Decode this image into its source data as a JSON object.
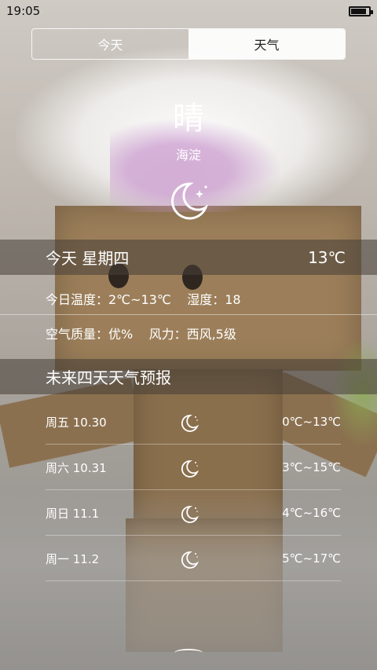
{
  "status_bar": {
    "time": "19:05",
    "battery_level": 0.85
  },
  "tabs": [
    {
      "label": "今天",
      "active": false
    },
    {
      "label": "天气",
      "active": true
    }
  ],
  "current": {
    "condition": "晴",
    "city": "海淀",
    "icon": "moon-stars-icon"
  },
  "today": {
    "label": "今天 星期四",
    "temp": "13℃",
    "temp_range": "今日温度：2℃~13℃",
    "humidity": "湿度：18",
    "air_quality": "空气质量：优%",
    "wind": "风力：西风,5级"
  },
  "forecast": {
    "title": "未来四天天气预报",
    "days": [
      {
        "day": "周五 10.30",
        "icon": "moon-icon",
        "range": "0℃~13℃"
      },
      {
        "day": "周六 10.31",
        "icon": "moon-icon",
        "range": "3℃~15℃"
      },
      {
        "day": "周日 11.1",
        "icon": "moon-icon",
        "range": "4℃~16℃"
      },
      {
        "day": "周一 11.2",
        "icon": "moon-icon",
        "range": "5℃~17℃"
      }
    ]
  }
}
